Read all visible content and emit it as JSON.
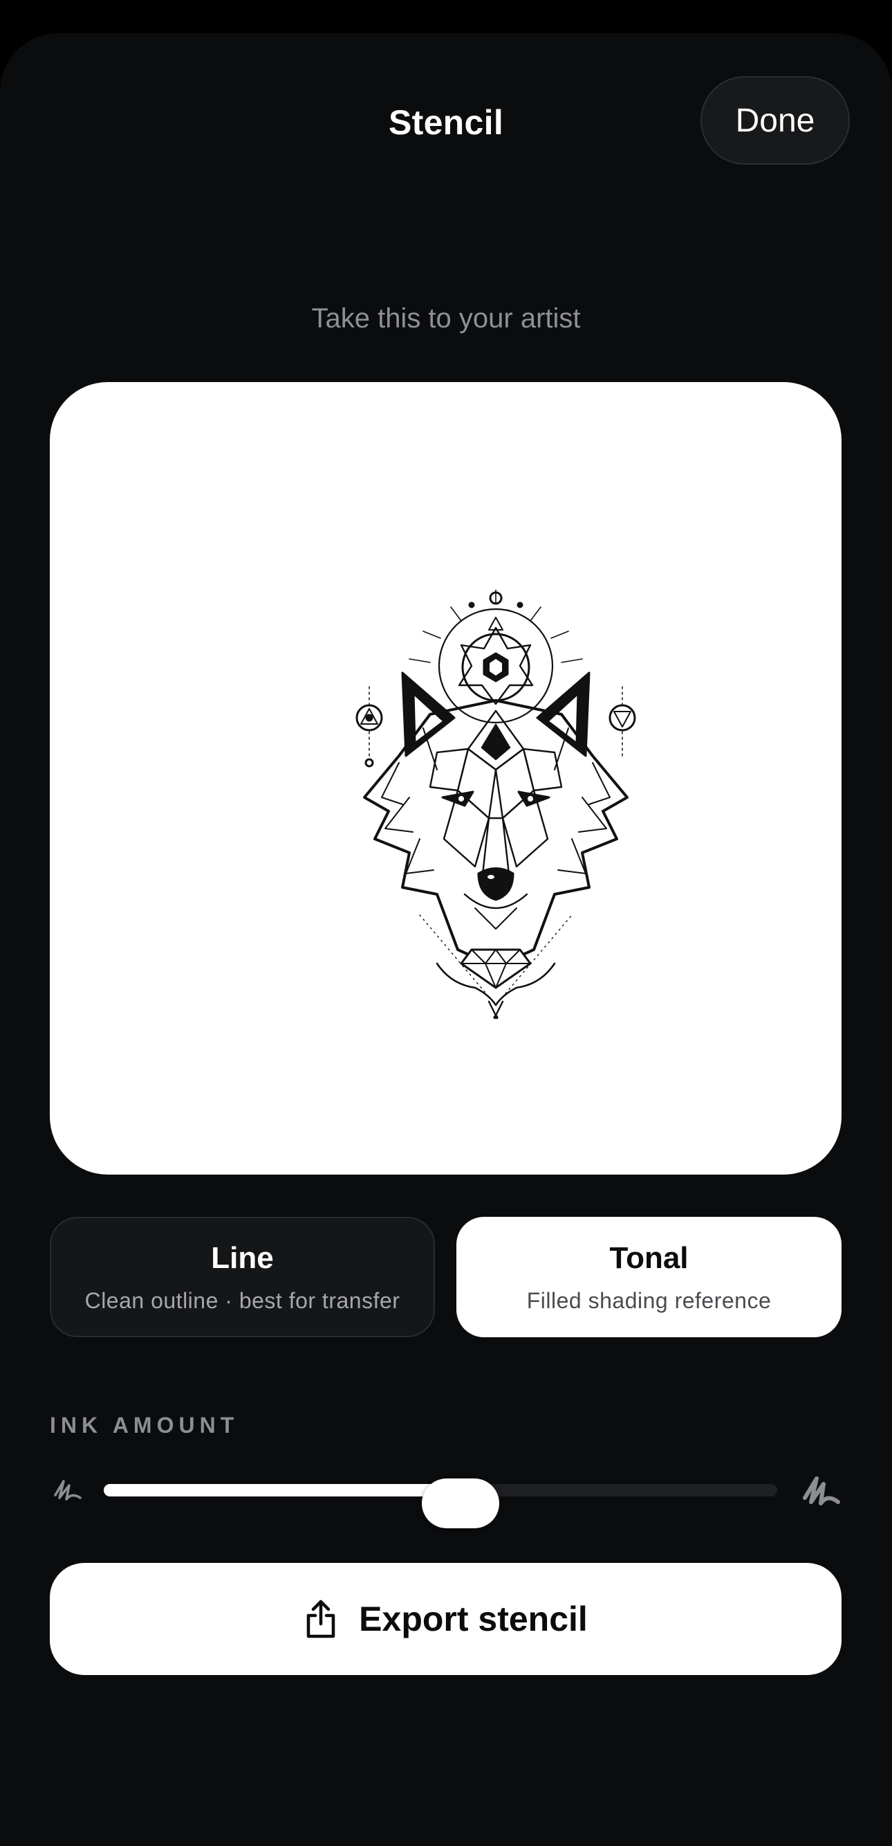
{
  "header": {
    "title": "Stencil",
    "done_label": "Done"
  },
  "preview": {
    "subtitle": "Take this to your artist",
    "image": "geometric-wolf-tattoo-stencil"
  },
  "modes": [
    {
      "label": "Line",
      "description": "Clean outline · best for transfer",
      "selected": false
    },
    {
      "label": "Tonal",
      "description": "Filled shading reference",
      "selected": true
    }
  ],
  "ink": {
    "label": "INK AMOUNT",
    "value": 0.53,
    "min_icon": "scribble-light-icon",
    "max_icon": "scribble-heavy-icon"
  },
  "export": {
    "label": "Export stencil",
    "icon": "share-icon"
  },
  "colors": {
    "background": "#0b0c0e",
    "card_dark": "#151618",
    "accent_light": "#ffffff",
    "muted_text": "#8f9094"
  }
}
